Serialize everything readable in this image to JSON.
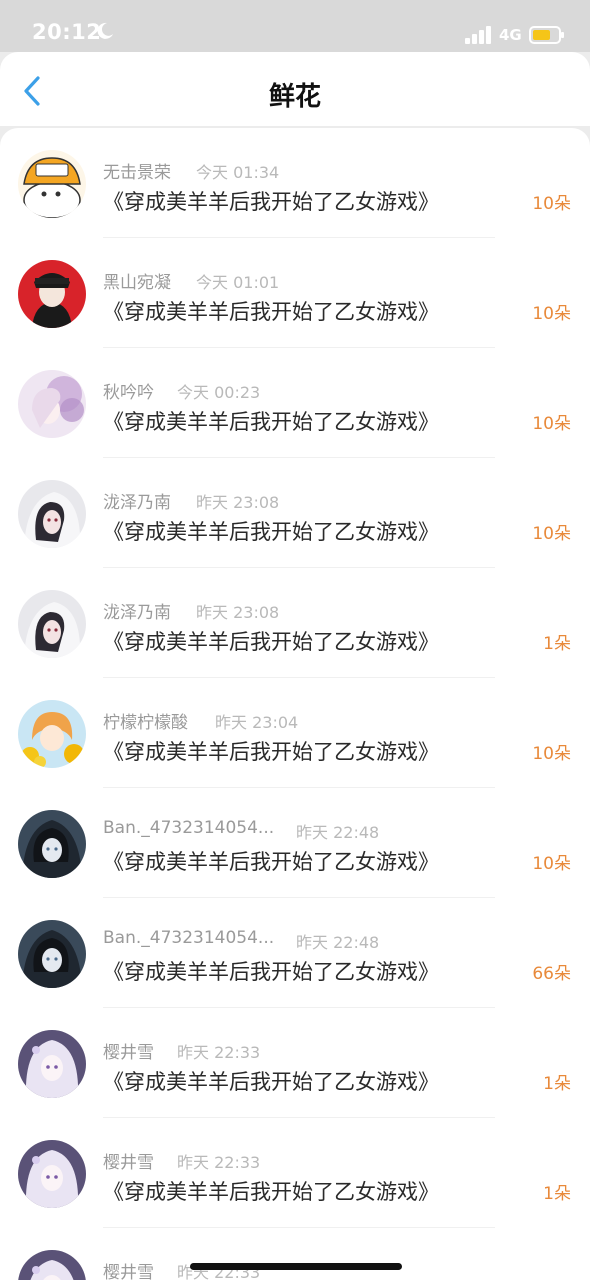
{
  "status_bar": {
    "time": "20:12",
    "network": "4G"
  },
  "header": {
    "title": "鲜花"
  },
  "items": [
    {
      "user": "无击景荣",
      "time": "今天 01:34",
      "book": "《穿成美羊羊后我开始了乙女游戏》",
      "amount": "10朵"
    },
    {
      "user": "黑山宛凝",
      "time": "今天 01:01",
      "book": "《穿成美羊羊后我开始了乙女游戏》",
      "amount": "10朵"
    },
    {
      "user": "秋吟吟",
      "time": "今天 00:23",
      "book": "《穿成美羊羊后我开始了乙女游戏》",
      "amount": "10朵"
    },
    {
      "user": "泷泽乃南",
      "time": "昨天 23:08",
      "book": "《穿成美羊羊后我开始了乙女游戏》",
      "amount": "10朵"
    },
    {
      "user": "泷泽乃南",
      "time": "昨天 23:08",
      "book": "《穿成美羊羊后我开始了乙女游戏》",
      "amount": "1朵"
    },
    {
      "user": "柠檬柠檬酸",
      "time": "昨天 23:04",
      "book": "《穿成美羊羊后我开始了乙女游戏》",
      "amount": "10朵"
    },
    {
      "user": "Ban._4732314054...",
      "time": "昨天 22:48",
      "book": "《穿成美羊羊后我开始了乙女游戏》",
      "amount": "10朵"
    },
    {
      "user": "Ban._4732314054...",
      "time": "昨天 22:48",
      "book": "《穿成美羊羊后我开始了乙女游戏》",
      "amount": "66朵"
    },
    {
      "user": "樱井雪",
      "time": "昨天 22:33",
      "book": "《穿成美羊羊后我开始了乙女游戏》",
      "amount": "1朵"
    },
    {
      "user": "樱井雪",
      "time": "昨天 22:33",
      "book": "《穿成美羊羊后我开始了乙女游戏》",
      "amount": "1朵"
    },
    {
      "user": "樱井雪",
      "time": "昨天 22:33",
      "book": "",
      "amount": ""
    }
  ]
}
